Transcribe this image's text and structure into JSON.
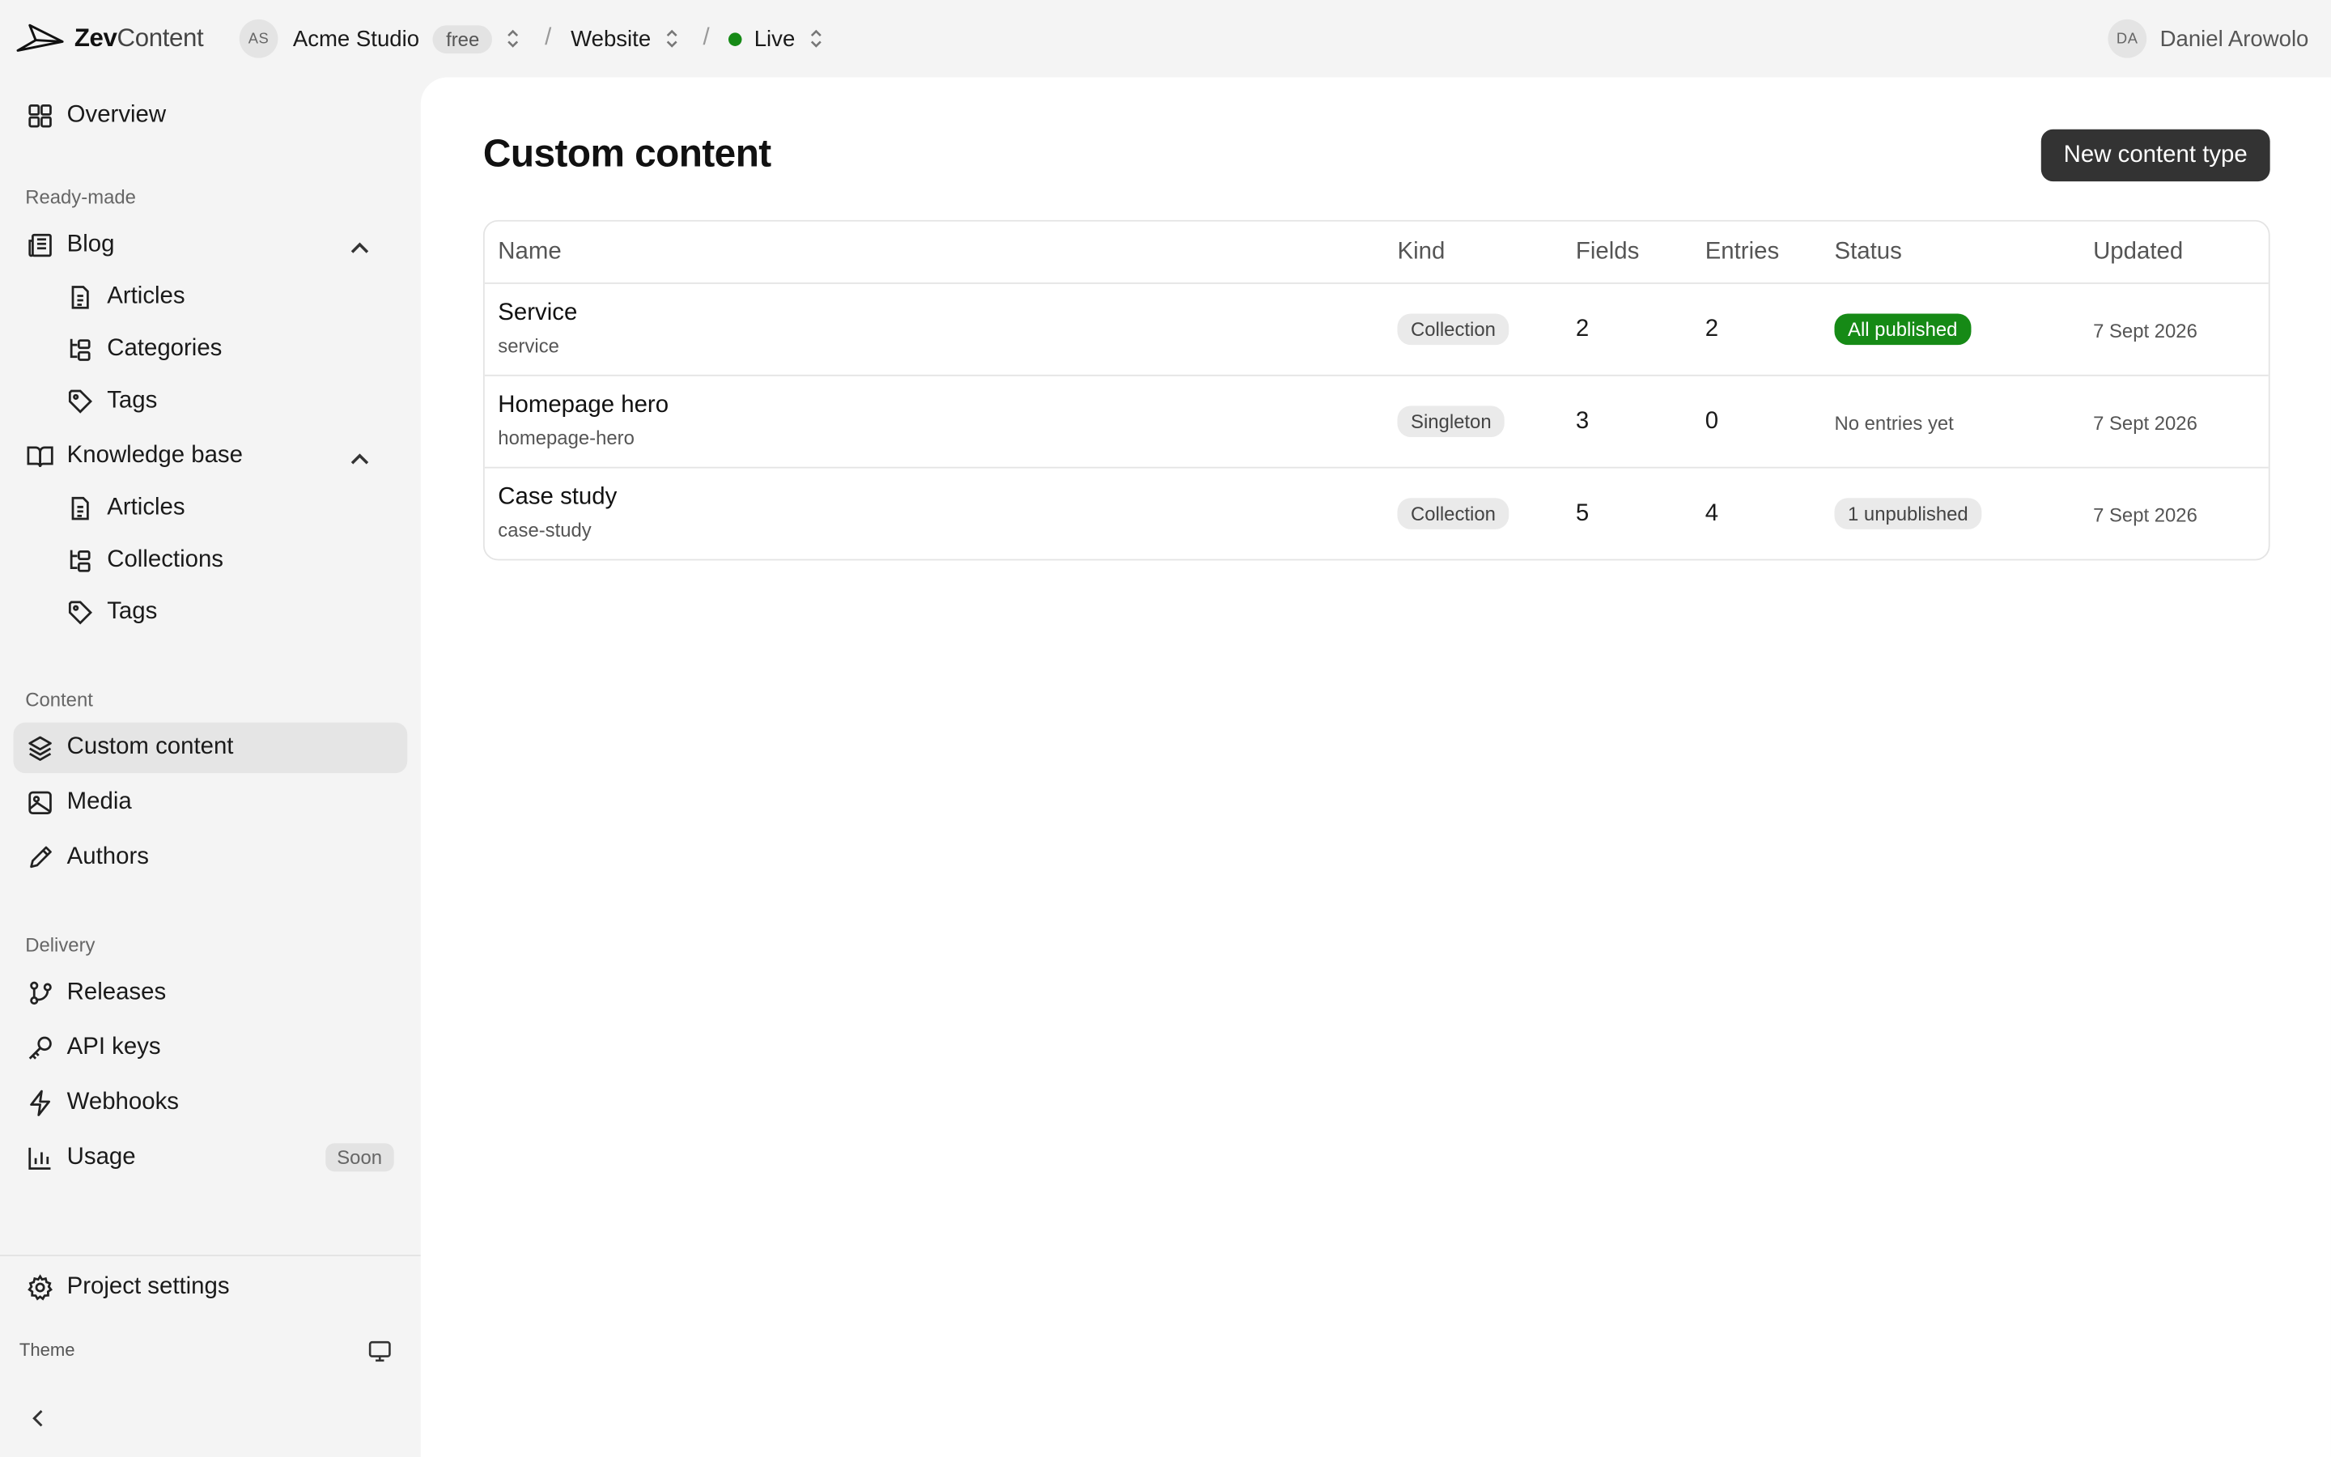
{
  "brand": {
    "name_bold": "Zev",
    "name_rest": "Content"
  },
  "topbar": {
    "org_initials": "AS",
    "org_name": "Acme Studio",
    "plan": "free",
    "project": "Website",
    "environment": "Live",
    "environment_color": "#168a16",
    "user_initials": "DA",
    "user_name": "Daniel Arowolo"
  },
  "sidebar": {
    "overview": "Overview",
    "ready_made_label": "Ready-made",
    "blog": {
      "label": "Blog",
      "items": [
        "Articles",
        "Categories",
        "Tags"
      ]
    },
    "knowledge_base": {
      "label": "Knowledge base",
      "items": [
        "Articles",
        "Collections",
        "Tags"
      ]
    },
    "content_label": "Content",
    "content_items": [
      "Custom content",
      "Media",
      "Authors"
    ],
    "delivery_label": "Delivery",
    "delivery_items": [
      "Releases",
      "API keys",
      "Webhooks",
      "Usage"
    ],
    "usage_badge": "Soon",
    "project_settings": "Project settings",
    "theme_label": "Theme"
  },
  "main": {
    "title": "Custom content",
    "new_button": "New content type",
    "columns": [
      "Name",
      "Kind",
      "Fields",
      "Entries",
      "Status",
      "Updated"
    ],
    "rows": [
      {
        "name": "Service",
        "slug": "service",
        "kind": "Collection",
        "fields": "2",
        "entries": "2",
        "status": "All published",
        "status_type": "published",
        "updated": "7 Sept 2026"
      },
      {
        "name": "Homepage hero",
        "slug": "homepage-hero",
        "kind": "Singleton",
        "fields": "3",
        "entries": "0",
        "status": "No entries yet",
        "status_type": "none",
        "updated": "7 Sept 2026"
      },
      {
        "name": "Case study",
        "slug": "case-study",
        "kind": "Collection",
        "fields": "5",
        "entries": "4",
        "status": "1 unpublished",
        "status_type": "unpublished",
        "updated": "7 Sept 2026"
      }
    ]
  },
  "colors": {
    "accent_dark": "#333333",
    "published_green": "#168a16",
    "sidebar_bg": "#f4f4f4"
  }
}
